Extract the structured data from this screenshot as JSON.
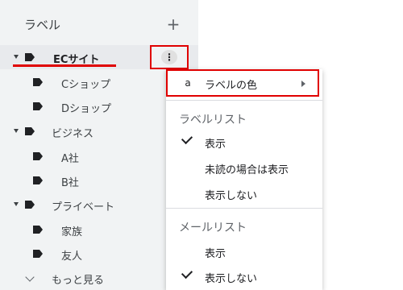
{
  "sidebar": {
    "title": "ラベル",
    "add_icon": "+",
    "items": [
      {
        "label": "ECサイト"
      },
      {
        "label": "Cショップ"
      },
      {
        "label": "Dショップ"
      },
      {
        "label": "ビジネス"
      },
      {
        "label": "A社"
      },
      {
        "label": "B社"
      },
      {
        "label": "プライベート"
      },
      {
        "label": "家族"
      },
      {
        "label": "友人"
      }
    ],
    "more_label": "もっと見る",
    "kebab_icon": "⋮"
  },
  "menu": {
    "label_color": {
      "badge": "a",
      "label": "ラベルの色"
    },
    "label_list": {
      "heading": "ラベルリスト",
      "options": [
        "表示",
        "未読の場合は表示",
        "表示しない"
      ]
    },
    "mail_list": {
      "heading": "メールリスト",
      "options": [
        "表示",
        "表示しない"
      ]
    }
  },
  "colors": {
    "highlight": "#e00000",
    "tag": "#202124",
    "sidebar_bg": "#f1f3f4"
  }
}
